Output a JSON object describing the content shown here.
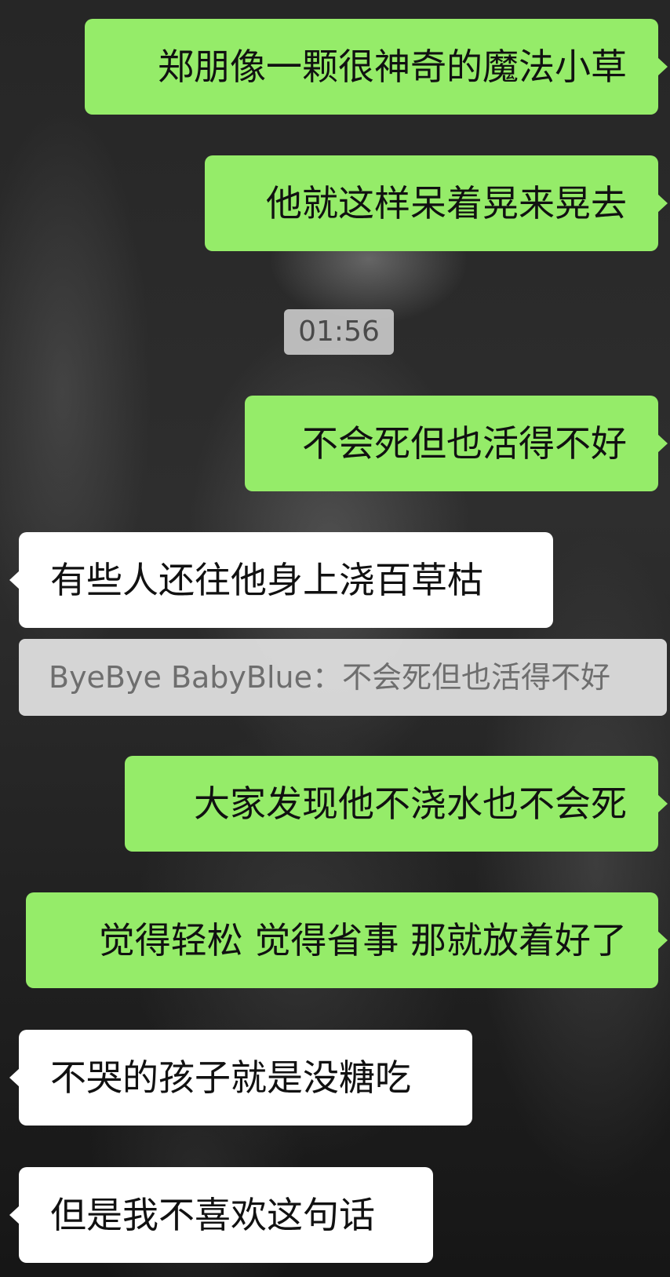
{
  "chat": {
    "messages": [
      {
        "id": "m1",
        "side": "sent",
        "text": "郑朋像一颗很神奇的魔法小草"
      },
      {
        "id": "m2",
        "side": "sent",
        "text": "他就这样呆着晃来晃去"
      },
      {
        "id": "m3",
        "side": "sent",
        "text": "不会死但也活得不好"
      },
      {
        "id": "m4",
        "side": "received",
        "text": "有些人还往他身上浇百草枯"
      },
      {
        "id": "m5",
        "side": "sent",
        "text": "大家发现他不浇水也不会死"
      },
      {
        "id": "m6",
        "side": "sent",
        "text": "觉得轻松 觉得省事 那就放着好了"
      },
      {
        "id": "m7",
        "side": "received",
        "text": "不哭的孩子就是没糖吃"
      },
      {
        "id": "m8",
        "side": "received",
        "text": "但是我不喜欢这句话"
      }
    ],
    "timestamp": "01:56",
    "quote": "ByeBye BabyBlue：不会死但也活得不好"
  },
  "colors": {
    "sent_bubble": "#95ec69",
    "received_bubble": "#ffffff",
    "timestamp_bg": "#c8c8c8",
    "quote_bg": "#dedede"
  }
}
